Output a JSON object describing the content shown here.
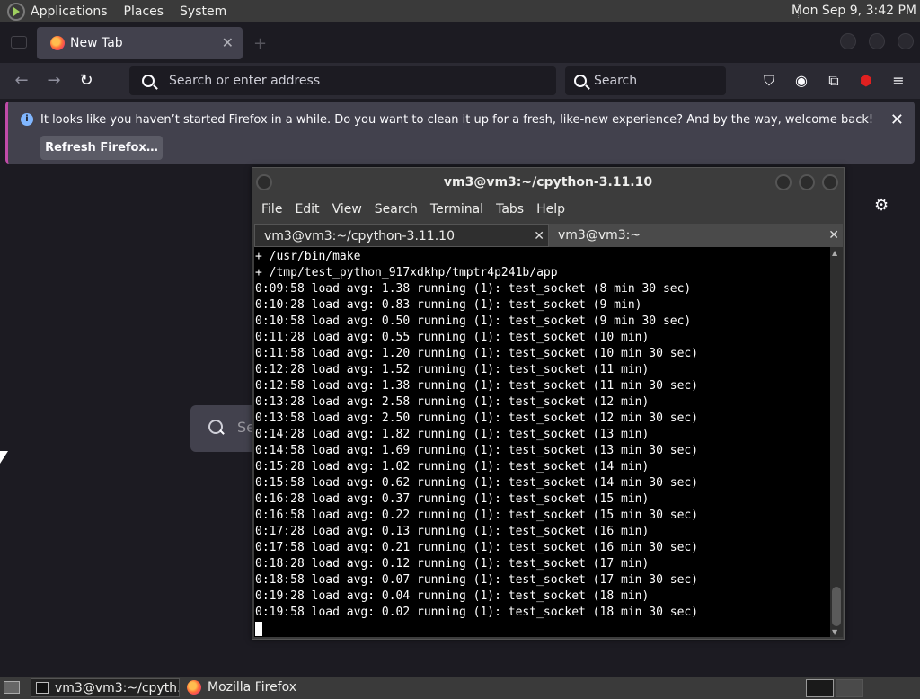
{
  "top_panel": {
    "menus": [
      "Applications",
      "Places",
      "System"
    ],
    "clock": "Mon Sep  9,  3:42 PM"
  },
  "firefox": {
    "tab_title": "New Tab",
    "url_placeholder": "Search or enter address",
    "search_placeholder": "Search",
    "notification": {
      "message": "It looks like you haven’t started Firefox in a while. Do you want to clean it up for a fresh, like-new experience? And by the way, welcome back!",
      "button": "Refresh Firefox…"
    },
    "page_search_partial": "Se"
  },
  "terminal": {
    "title": "vm3@vm3:~/cpython-3.11.10",
    "menu": [
      "File",
      "Edit",
      "View",
      "Search",
      "Terminal",
      "Tabs",
      "Help"
    ],
    "tabs": [
      {
        "label": "vm3@vm3:~/cpython-3.11.10",
        "active": true
      },
      {
        "label": "vm3@vm3:~",
        "active": false
      }
    ],
    "lines": [
      "+ /usr/bin/make",
      "+ /tmp/test_python_917xdkhp/tmptr4p241b/app",
      "0:09:58 load avg: 1.38 running (1): test_socket (8 min 30 sec)",
      "0:10:28 load avg: 0.83 running (1): test_socket (9 min)",
      "0:10:58 load avg: 0.50 running (1): test_socket (9 min 30 sec)",
      "0:11:28 load avg: 0.55 running (1): test_socket (10 min)",
      "0:11:58 load avg: 1.20 running (1): test_socket (10 min 30 sec)",
      "0:12:28 load avg: 1.52 running (1): test_socket (11 min)",
      "0:12:58 load avg: 1.38 running (1): test_socket (11 min 30 sec)",
      "0:13:28 load avg: 2.58 running (1): test_socket (12 min)",
      "0:13:58 load avg: 2.50 running (1): test_socket (12 min 30 sec)",
      "0:14:28 load avg: 1.82 running (1): test_socket (13 min)",
      "0:14:58 load avg: 1.69 running (1): test_socket (13 min 30 sec)",
      "0:15:28 load avg: 1.02 running (1): test_socket (14 min)",
      "0:15:58 load avg: 0.62 running (1): test_socket (14 min 30 sec)",
      "0:16:28 load avg: 0.37 running (1): test_socket (15 min)",
      "0:16:58 load avg: 0.22 running (1): test_socket (15 min 30 sec)",
      "0:17:28 load avg: 0.13 running (1): test_socket (16 min)",
      "0:17:58 load avg: 0.21 running (1): test_socket (16 min 30 sec)",
      "0:18:28 load avg: 0.12 running (1): test_socket (17 min)",
      "0:18:58 load avg: 0.07 running (1): test_socket (17 min 30 sec)",
      "0:19:28 load avg: 0.04 running (1): test_socket (18 min)",
      "0:19:58 load avg: 0.02 running (1): test_socket (18 min 30 sec)"
    ]
  },
  "bottom_panel": {
    "tasks": [
      "vm3@vm3:~/cpyth…",
      "Mozilla Firefox"
    ]
  }
}
